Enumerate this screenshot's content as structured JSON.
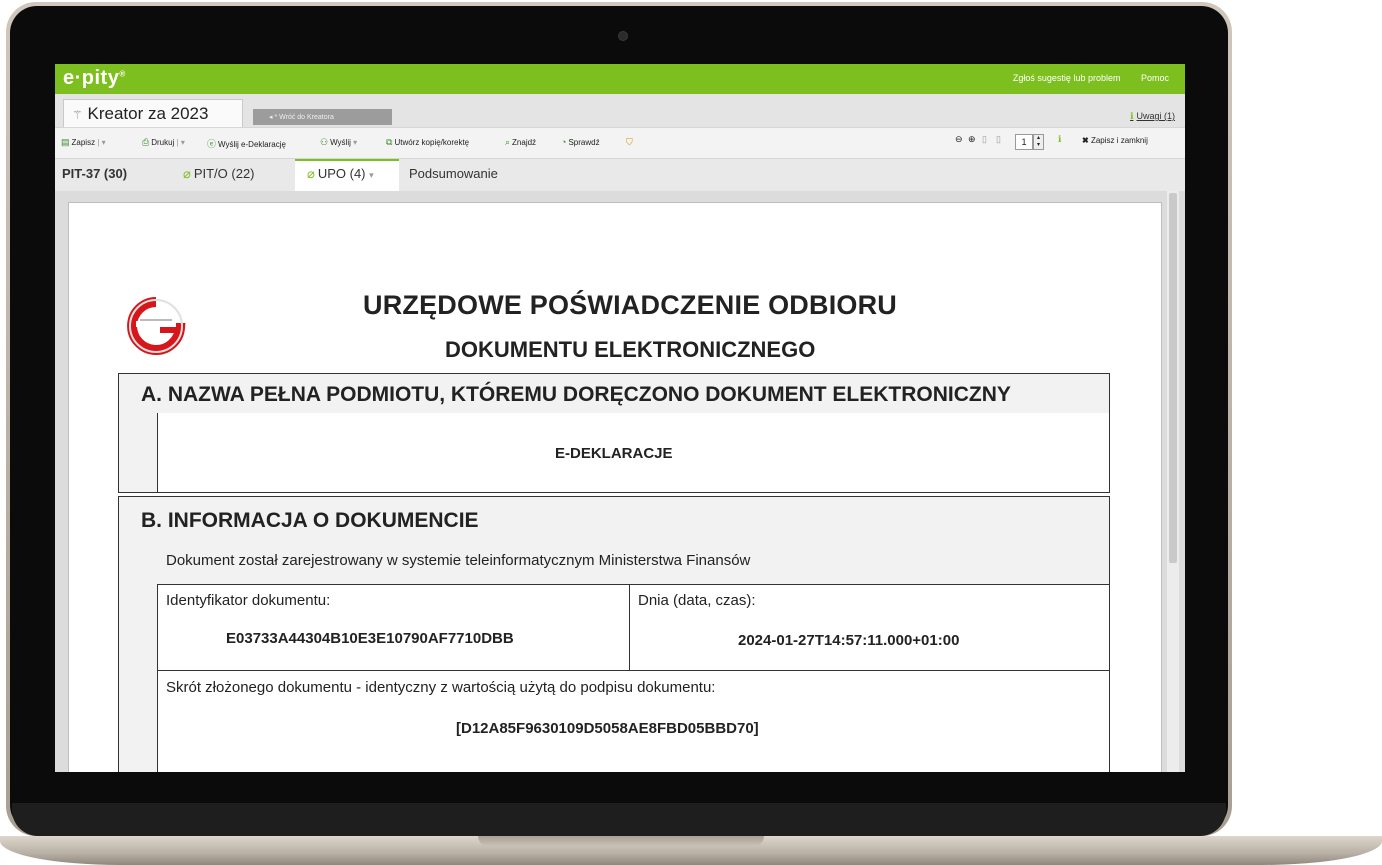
{
  "app": {
    "logo": "e·pity",
    "logo_mark": "®",
    "top_links": [
      "Zgłoś sugestię lub problem",
      "Pomoc"
    ]
  },
  "tabs": {
    "main": "Kreator za 2023",
    "back": "Wróć do Kreatora",
    "uwagi": "Uwagi (1)"
  },
  "toolbar": {
    "zapisz": "Zapisz",
    "drukuj": "Drukuj",
    "wyslij_edeklaracje": "Wyślij e-Deklarację",
    "wyslij": "Wyślij",
    "utworz_kopie": "Utwórz kopię/korektę",
    "znajdz": "Znajdź",
    "sprawdz": "Sprawdź",
    "page_number": "1",
    "zapisz_zamknij": "Zapisz i zamknij"
  },
  "document_tabs": [
    {
      "label": "PIT-37 (30)"
    },
    {
      "label": "PIT/O (22)"
    },
    {
      "label": "UPO (4)"
    },
    {
      "label": "Podsumowanie"
    }
  ],
  "document": {
    "title": "URZĘDOWE POŚWIADCZENIE ODBIORU",
    "subtitle": "DOKUMENTU ELEKTRONICZNEGO",
    "section_a": {
      "heading": "A. NAZWA PEŁNA PODMIOTU, KTÓREMU DORĘCZONO DOKUMENT ELEKTRONICZNY",
      "value": "E-DEKLARACJE"
    },
    "section_b": {
      "heading": "B. INFORMACJA O DOKUMENCIE",
      "info": "Dokument został zarejestrowany w systemie teleinformatycznym Ministerstwa Finansów",
      "id_label": "Identyfikator dokumentu:",
      "id_value": "E03733A44304B10E3E10790AF7710DBB",
      "date_label": "Dnia (data, czas):",
      "date_value": "2024-01-27T14:57:11.000+01:00",
      "hash_label": "Skrót złożonego dokumentu - identyczny z wartością użytą do podpisu dokumentu:",
      "hash_value": "[D12A85F9630109D5058AE8FBD05BBD70]"
    }
  },
  "colors": {
    "brand_green": "#7cbf1e",
    "logo_red": "#d6161b"
  }
}
